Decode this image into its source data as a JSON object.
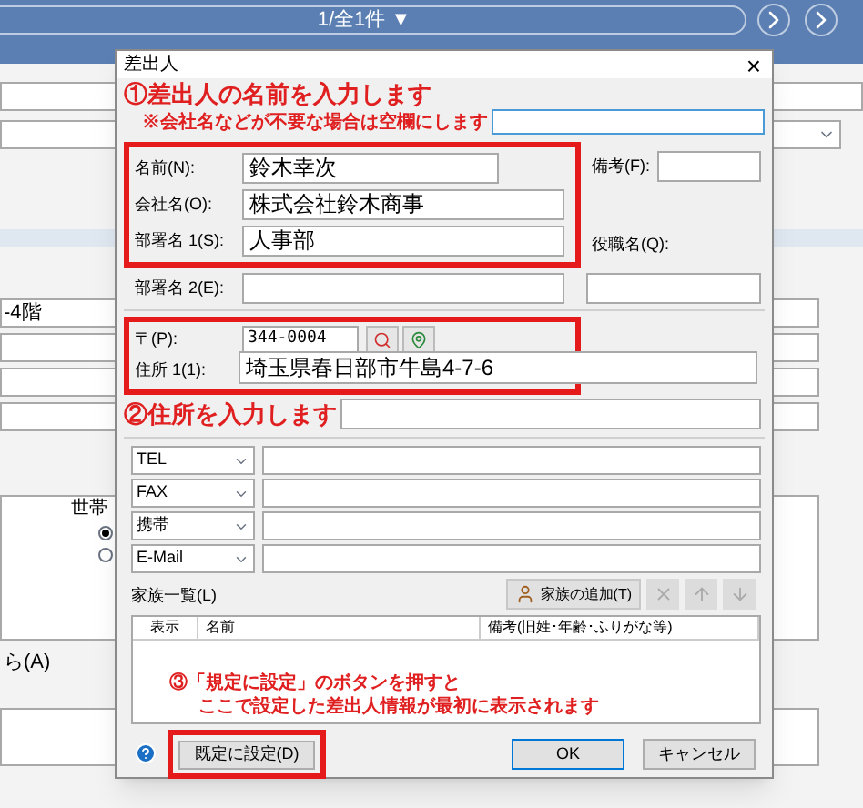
{
  "background": {
    "pager": "1/全1件 ▼",
    "address_line": "-4階",
    "table_column": "世帯",
    "table_rows": [
      {
        "selected": true
      },
      {
        "selected": false
      }
    ],
    "option_label": "ら(A)"
  },
  "dialog": {
    "title": "差出人",
    "close": "×",
    "note_1": {
      "title": "①差出人の名前を入力します",
      "sub": "※会社名などが不要な場合は空欄にします"
    },
    "name_fields": [
      {
        "label": "名前(N):",
        "value": "鈴木幸次"
      },
      {
        "label": "会社名(O):",
        "value": "株式会社鈴木商事"
      },
      {
        "label": "部署名 1(S):",
        "value": "人事部"
      }
    ],
    "remarks_label": "備考(F):",
    "position_label": "役職名(Q):",
    "dept2_label": "部署名 2(E):",
    "postal": {
      "label": "〒(P):",
      "value": "344-0004"
    },
    "address1": {
      "label": "住所 1(1):",
      "value": "埼玉県春日部市牛島4-7-6"
    },
    "note_2": "②住所を入力します",
    "contacts": [
      {
        "type": "TEL"
      },
      {
        "type": "FAX"
      },
      {
        "type": "携帯"
      },
      {
        "type": "E-Mail"
      }
    ],
    "family_label": "家族一覧(L)",
    "add_family": "家族の追加(T)",
    "family_columns": [
      "表示",
      "名前",
      "備考(旧姓･年齢･ふりがな等)"
    ],
    "note_3": [
      "③「規定に設定」のボタンを押すと",
      "ここで設定した差出人情報が最初に表示されます"
    ],
    "default_button": "既定に設定(D)",
    "ok": "OK",
    "cancel": "キャンセル"
  }
}
